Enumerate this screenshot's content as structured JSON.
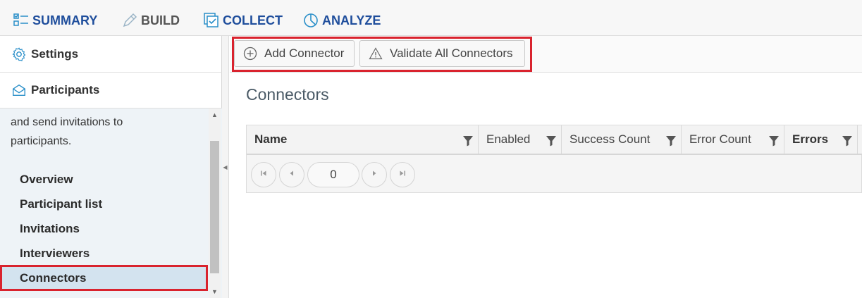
{
  "topnav": {
    "tabs": [
      {
        "label": "SUMMARY",
        "icon": "checklist-icon"
      },
      {
        "label": "BUILD",
        "icon": "pencil-icon"
      },
      {
        "label": "COLLECT",
        "icon": "collect-icon"
      },
      {
        "label": "ANALYZE",
        "icon": "pie-chart-icon"
      }
    ]
  },
  "sidebar": {
    "settings_label": "Settings",
    "participants_label": "Participants",
    "description_line1": "and send invitations to",
    "description_line2": "participants.",
    "items": [
      {
        "label": "Overview"
      },
      {
        "label": "Participant list"
      },
      {
        "label": "Invitations"
      },
      {
        "label": "Interviewers"
      },
      {
        "label": "Connectors"
      }
    ]
  },
  "toolbar": {
    "add_label": "Add Connector",
    "validate_label": "Validate All Connectors"
  },
  "main": {
    "title": "Connectors"
  },
  "grid": {
    "columns": [
      "Name",
      "Enabled",
      "Success Count",
      "Error Count",
      "Errors"
    ],
    "page_value": "0"
  },
  "colors": {
    "nav_blue": "#1f4e9c",
    "highlight_red": "#d9232e",
    "active_item_bg": "#d3e3ef",
    "panel_bg": "#eef3f7"
  }
}
